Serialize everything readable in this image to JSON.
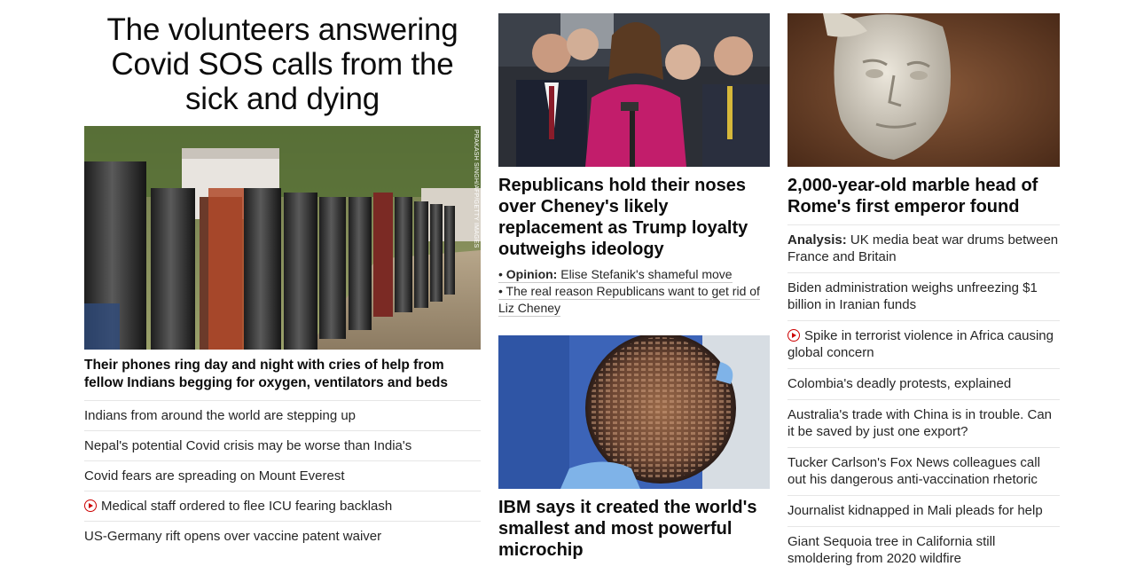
{
  "col1": {
    "headline": "The volunteers answering Covid SOS calls from the sick and dying",
    "image_credit": "PRAKASH SINGH/AFP/GETTY IMAGES",
    "lead": "Their phones ring day and night with cries of help from fellow Indians begging for oxygen, ventilators and beds",
    "items": [
      {
        "text": "Indians from around the world are stepping up",
        "video": false
      },
      {
        "text": "Nepal's potential Covid crisis may be worse than India's",
        "video": false
      },
      {
        "text": "Covid fears are spreading on Mount Everest",
        "video": false
      },
      {
        "text": "Medical staff ordered to flee ICU fearing backlash",
        "video": true
      },
      {
        "text": "US-Germany rift opens over vaccine patent waiver",
        "video": false
      }
    ]
  },
  "col2": {
    "story1": {
      "headline": "Republicans hold their noses over Cheney's likely replacement as Trump loyalty outweighs ideology",
      "bullets": [
        {
          "prefix": "Opinion:",
          "text": " Elise Stefanik's shameful move"
        },
        {
          "prefix": "",
          "text": "The real reason Republicans want to get rid of Liz Cheney"
        }
      ]
    },
    "story2": {
      "headline": "IBM says it created the world's smallest and most powerful microchip"
    }
  },
  "col3": {
    "headline": "2,000-year-old marble head of Rome's first emperor found",
    "items": [
      {
        "prefix": "Analysis:",
        "text": " UK media beat war drums between France and Britain",
        "video": false
      },
      {
        "prefix": "",
        "text": "Biden administration weighs unfreezing $1 billion in Iranian funds",
        "video": false
      },
      {
        "prefix": "",
        "text": "Spike in terrorist violence in Africa causing global concern",
        "video": true
      },
      {
        "prefix": "",
        "text": "Colombia's deadly protests, explained",
        "video": false
      },
      {
        "prefix": "",
        "text": "Australia's trade with China is in trouble. Can it be saved by just one export?",
        "video": false
      },
      {
        "prefix": "",
        "text": "Tucker Carlson's Fox News colleagues call out his dangerous anti-vaccination rhetoric",
        "video": false
      },
      {
        "prefix": "",
        "text": "Journalist kidnapped in Mali pleads for help",
        "video": false
      },
      {
        "prefix": "",
        "text": "Giant Sequoia tree in California still smoldering from 2020 wildfire",
        "video": false
      }
    ]
  },
  "colors": {
    "video_icon": "#cc0000",
    "divider": "#e6e6e6",
    "text": "#262626"
  }
}
